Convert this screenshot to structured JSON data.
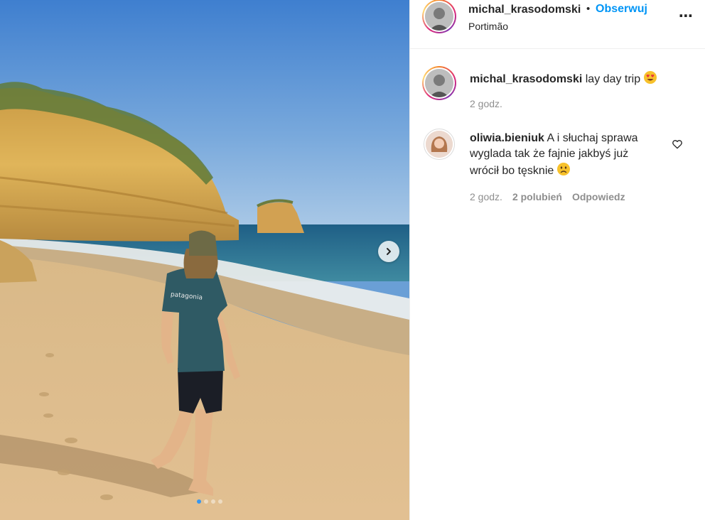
{
  "post": {
    "author": "michal_krasodomski",
    "separator": "•",
    "follow_label": "Obserwuj",
    "location": "Portimão",
    "more_label": "•••",
    "caption_author": "michal_krasodomski",
    "caption_text": "lay day trip",
    "caption_emoji": "heart-eyes-emoji",
    "caption_time": "2 godz.",
    "carousel": {
      "total_slides": 4,
      "current_slide": 1
    }
  },
  "comment": {
    "author": "oliwia.bieniuk",
    "text": "A i słuchaj sprawa wyglada tak że fajnie jakbyś już wrócił bo tęsknie",
    "emoji": "sad-face-emoji",
    "time": "2 godz.",
    "likes": "2 polubień",
    "reply_label": "Odpowiedz"
  },
  "icons": {
    "next": "chevron-right-icon",
    "like": "heart-outline-icon"
  },
  "colors": {
    "link_blue": "#0095f6",
    "muted": "#8e8e8e",
    "text": "#262626"
  }
}
